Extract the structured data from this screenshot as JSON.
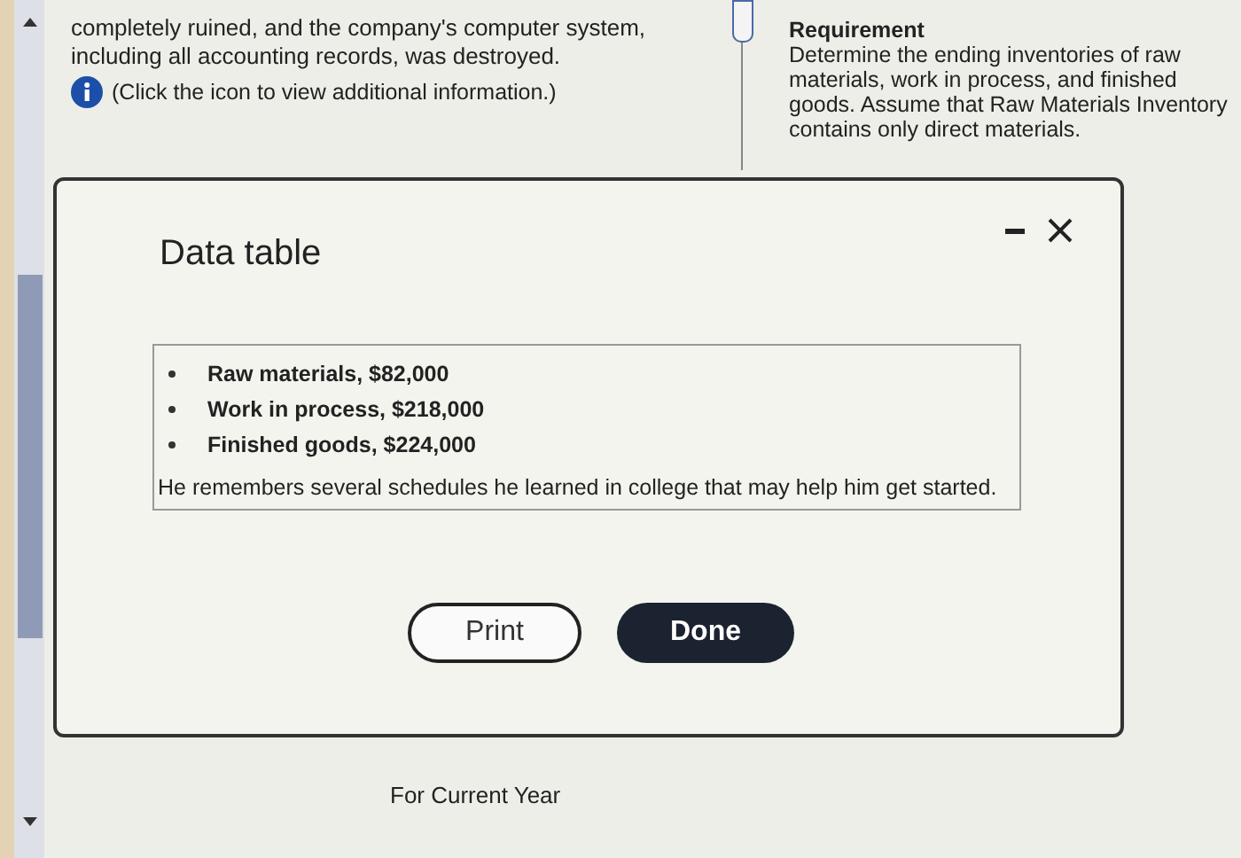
{
  "problem": {
    "text_lines": [
      "completely ruined, and the company's computer system,",
      "including all accounting records, was destroyed."
    ],
    "info_link": "(Click the icon to view additional information.)"
  },
  "requirement": {
    "heading": "Requirement",
    "text": "Determine the ending inventories of raw materials, work in process, and finished goods. Assume that Raw Materials Inventory contains only direct materials."
  },
  "worksheet": {
    "subtitle": "For Current Year"
  },
  "dialog": {
    "title": "Data table",
    "items": [
      "Raw materials, $82,000",
      "Work in process, $218,000",
      "Finished goods, $224,000"
    ],
    "note": "He remembers several schedules he learned in college that may help him get started.",
    "buttons": [
      {
        "label": "Print",
        "kind": "secondary"
      },
      {
        "label": "Done",
        "kind": "primary"
      }
    ]
  }
}
